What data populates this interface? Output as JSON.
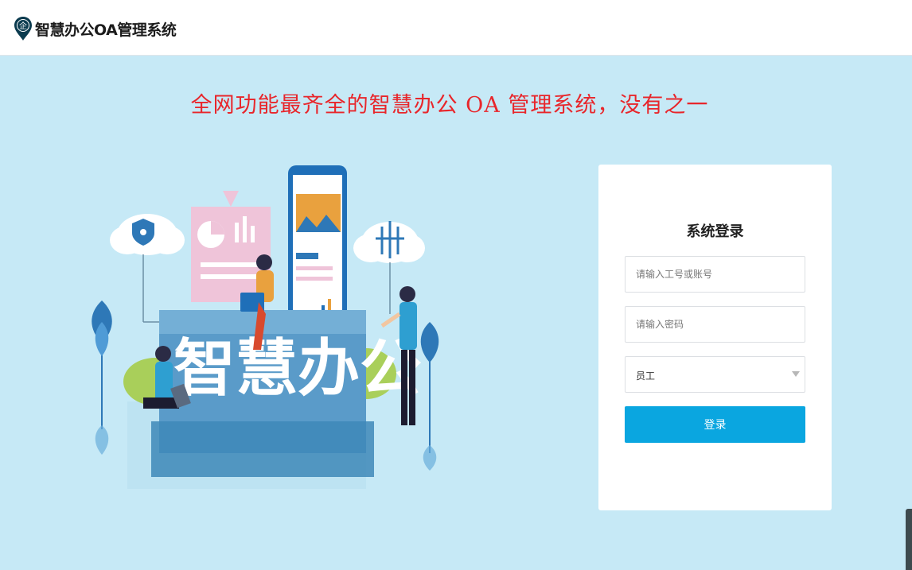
{
  "header": {
    "logo_icon": "enterprise-pin-icon",
    "title": "智慧办公OA管理系统"
  },
  "slogan": "全网功能最齐全的智慧办公 OA 管理系统，没有之一",
  "illustration": {
    "big_text": "智慧办公"
  },
  "login": {
    "title": "系统登录",
    "username_placeholder": "请输入工号或账号",
    "password_placeholder": "请输入密码",
    "role_selected": "员工",
    "submit_label": "登录"
  },
  "colors": {
    "background": "#c6e9f6",
    "slogan": "#e8262b",
    "button": "#0aa6e0"
  }
}
